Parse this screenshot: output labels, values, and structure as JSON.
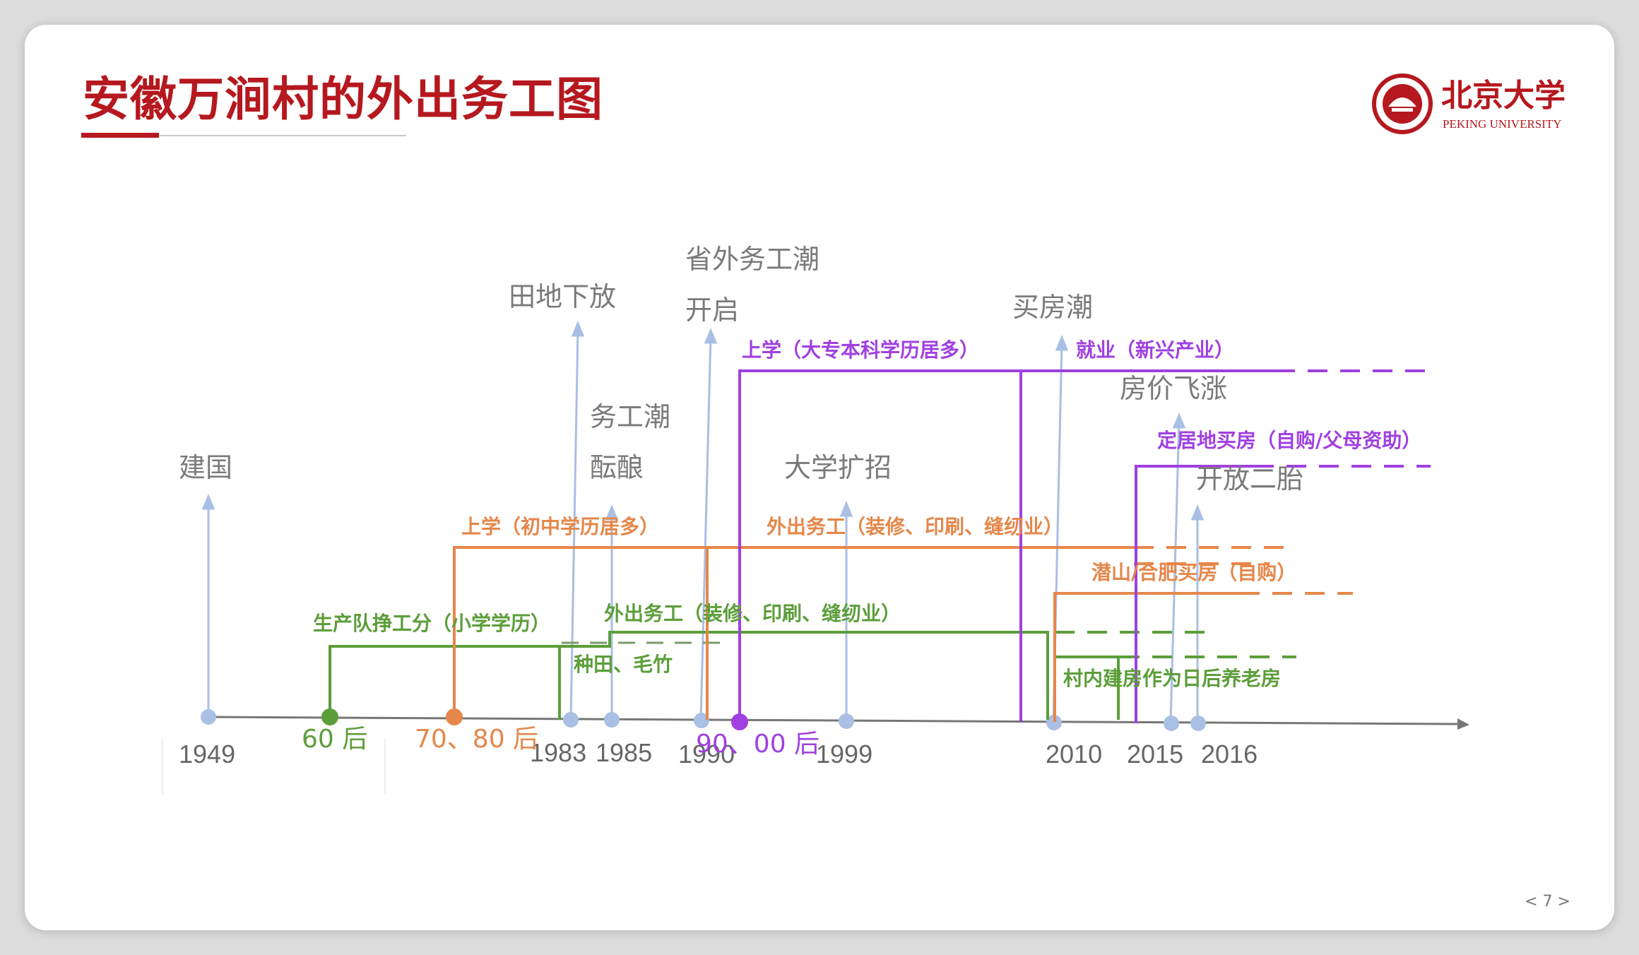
{
  "title": "安徽万涧村的外出务工图",
  "logo": {
    "name_cn": "北京大学",
    "name_en": "PEKING UNIVERSITY"
  },
  "page_number": "< 7 >",
  "colors": {
    "title": "#b5181e",
    "axis": "#777777",
    "year_marker": "#a9bfe3",
    "gen60": "#5c9e3a",
    "gen70": "#e5874a",
    "gen90": "#a040e0",
    "event_text": "#7a7a7a"
  },
  "generations": [
    {
      "label": "60 后",
      "color_key": "gen60"
    },
    {
      "label": "70、80 后",
      "color_key": "gen70"
    },
    {
      "label": "90、00 后",
      "color_key": "gen90"
    }
  ],
  "years": [
    "1949",
    "1983",
    "1985",
    "1990",
    "1999",
    "2010",
    "2015",
    "2016"
  ],
  "events": [
    "建国",
    "田地下放",
    "务工潮",
    "酝酿",
    "省外务工潮",
    "开启",
    "大学扩招",
    "买房潮",
    "房价飞涨",
    "开放二胎"
  ],
  "phases": {
    "gen60": [
      "生产队挣工分（小学学历）",
      "种田、毛竹",
      "外出务工（装修、印刷、缝纫业）",
      "村内建房作为日后养老房"
    ],
    "gen70": [
      "上学（初中学历居多）",
      "外出务工（装修、印刷、缝纫业）",
      "潜山/合肥买房（自购）"
    ],
    "gen90": [
      "上学（大专本科学历居多）",
      "就业（新兴产业）",
      "定居地买房（自购/父母资助）"
    ]
  }
}
